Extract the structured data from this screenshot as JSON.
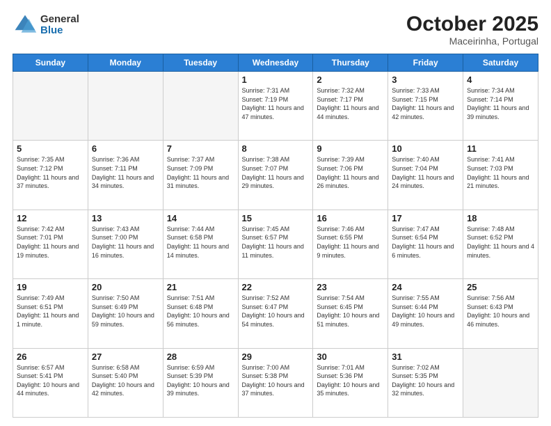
{
  "header": {
    "logo_general": "General",
    "logo_blue": "Blue",
    "month_title": "October 2025",
    "location": "Maceirinha, Portugal"
  },
  "days_of_week": [
    "Sunday",
    "Monday",
    "Tuesday",
    "Wednesday",
    "Thursday",
    "Friday",
    "Saturday"
  ],
  "weeks": [
    [
      {
        "day": "",
        "info": ""
      },
      {
        "day": "",
        "info": ""
      },
      {
        "day": "",
        "info": ""
      },
      {
        "day": "1",
        "info": "Sunrise: 7:31 AM\nSunset: 7:19 PM\nDaylight: 11 hours and 47 minutes."
      },
      {
        "day": "2",
        "info": "Sunrise: 7:32 AM\nSunset: 7:17 PM\nDaylight: 11 hours and 44 minutes."
      },
      {
        "day": "3",
        "info": "Sunrise: 7:33 AM\nSunset: 7:15 PM\nDaylight: 11 hours and 42 minutes."
      },
      {
        "day": "4",
        "info": "Sunrise: 7:34 AM\nSunset: 7:14 PM\nDaylight: 11 hours and 39 minutes."
      }
    ],
    [
      {
        "day": "5",
        "info": "Sunrise: 7:35 AM\nSunset: 7:12 PM\nDaylight: 11 hours and 37 minutes."
      },
      {
        "day": "6",
        "info": "Sunrise: 7:36 AM\nSunset: 7:11 PM\nDaylight: 11 hours and 34 minutes."
      },
      {
        "day": "7",
        "info": "Sunrise: 7:37 AM\nSunset: 7:09 PM\nDaylight: 11 hours and 31 minutes."
      },
      {
        "day": "8",
        "info": "Sunrise: 7:38 AM\nSunset: 7:07 PM\nDaylight: 11 hours and 29 minutes."
      },
      {
        "day": "9",
        "info": "Sunrise: 7:39 AM\nSunset: 7:06 PM\nDaylight: 11 hours and 26 minutes."
      },
      {
        "day": "10",
        "info": "Sunrise: 7:40 AM\nSunset: 7:04 PM\nDaylight: 11 hours and 24 minutes."
      },
      {
        "day": "11",
        "info": "Sunrise: 7:41 AM\nSunset: 7:03 PM\nDaylight: 11 hours and 21 minutes."
      }
    ],
    [
      {
        "day": "12",
        "info": "Sunrise: 7:42 AM\nSunset: 7:01 PM\nDaylight: 11 hours and 19 minutes."
      },
      {
        "day": "13",
        "info": "Sunrise: 7:43 AM\nSunset: 7:00 PM\nDaylight: 11 hours and 16 minutes."
      },
      {
        "day": "14",
        "info": "Sunrise: 7:44 AM\nSunset: 6:58 PM\nDaylight: 11 hours and 14 minutes."
      },
      {
        "day": "15",
        "info": "Sunrise: 7:45 AM\nSunset: 6:57 PM\nDaylight: 11 hours and 11 minutes."
      },
      {
        "day": "16",
        "info": "Sunrise: 7:46 AM\nSunset: 6:55 PM\nDaylight: 11 hours and 9 minutes."
      },
      {
        "day": "17",
        "info": "Sunrise: 7:47 AM\nSunset: 6:54 PM\nDaylight: 11 hours and 6 minutes."
      },
      {
        "day": "18",
        "info": "Sunrise: 7:48 AM\nSunset: 6:52 PM\nDaylight: 11 hours and 4 minutes."
      }
    ],
    [
      {
        "day": "19",
        "info": "Sunrise: 7:49 AM\nSunset: 6:51 PM\nDaylight: 11 hours and 1 minute."
      },
      {
        "day": "20",
        "info": "Sunrise: 7:50 AM\nSunset: 6:49 PM\nDaylight: 10 hours and 59 minutes."
      },
      {
        "day": "21",
        "info": "Sunrise: 7:51 AM\nSunset: 6:48 PM\nDaylight: 10 hours and 56 minutes."
      },
      {
        "day": "22",
        "info": "Sunrise: 7:52 AM\nSunset: 6:47 PM\nDaylight: 10 hours and 54 minutes."
      },
      {
        "day": "23",
        "info": "Sunrise: 7:54 AM\nSunset: 6:45 PM\nDaylight: 10 hours and 51 minutes."
      },
      {
        "day": "24",
        "info": "Sunrise: 7:55 AM\nSunset: 6:44 PM\nDaylight: 10 hours and 49 minutes."
      },
      {
        "day": "25",
        "info": "Sunrise: 7:56 AM\nSunset: 6:43 PM\nDaylight: 10 hours and 46 minutes."
      }
    ],
    [
      {
        "day": "26",
        "info": "Sunrise: 6:57 AM\nSunset: 5:41 PM\nDaylight: 10 hours and 44 minutes."
      },
      {
        "day": "27",
        "info": "Sunrise: 6:58 AM\nSunset: 5:40 PM\nDaylight: 10 hours and 42 minutes."
      },
      {
        "day": "28",
        "info": "Sunrise: 6:59 AM\nSunset: 5:39 PM\nDaylight: 10 hours and 39 minutes."
      },
      {
        "day": "29",
        "info": "Sunrise: 7:00 AM\nSunset: 5:38 PM\nDaylight: 10 hours and 37 minutes."
      },
      {
        "day": "30",
        "info": "Sunrise: 7:01 AM\nSunset: 5:36 PM\nDaylight: 10 hours and 35 minutes."
      },
      {
        "day": "31",
        "info": "Sunrise: 7:02 AM\nSunset: 5:35 PM\nDaylight: 10 hours and 32 minutes."
      },
      {
        "day": "",
        "info": ""
      }
    ]
  ]
}
